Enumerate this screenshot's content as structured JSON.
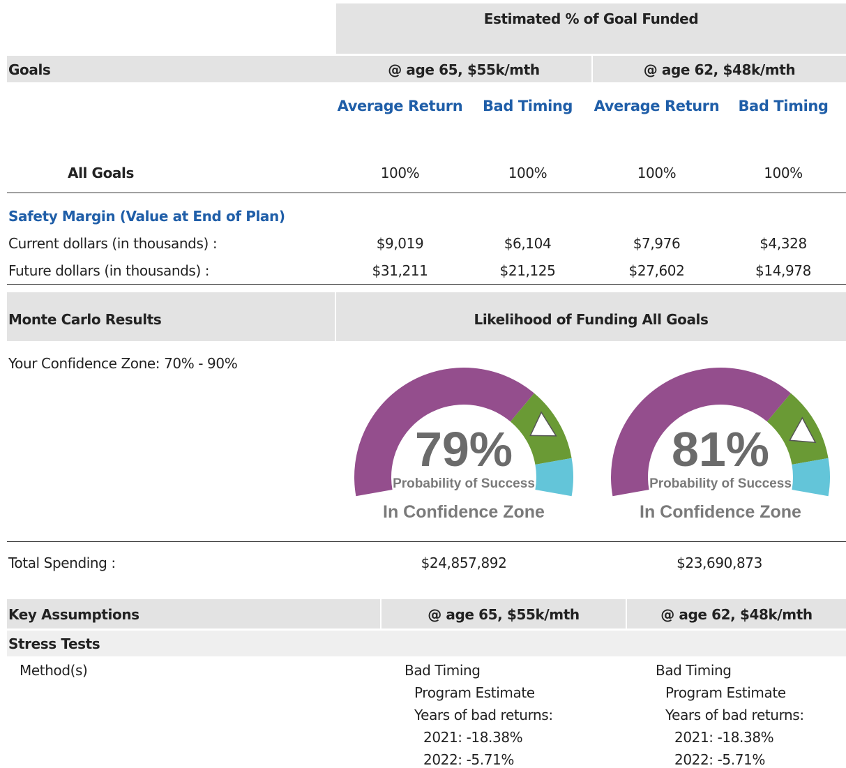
{
  "colors": {
    "header_bg": "#e3e3e3",
    "link_blue": "#1f5ea8",
    "gauge_purple": "#944e8d",
    "gauge_green": "#6a9a35",
    "gauge_cyan": "#63c5d9",
    "gauge_text": "#6b6b6b"
  },
  "funded": {
    "title": "Estimated % of Goal Funded",
    "goals_label": "Goals",
    "scenarios": [
      "@ age 65, $55k/mth",
      "@ age 62, $48k/mth"
    ],
    "subheaders": [
      "Average Return",
      "Bad Timing",
      "Average Return",
      "Bad Timing"
    ],
    "all_goals_label": "All Goals",
    "all_goals_values": [
      "100%",
      "100%",
      "100%",
      "100%"
    ]
  },
  "safety": {
    "title": "Safety Margin (Value at End of Plan)",
    "rows": [
      {
        "label": "Current dollars (in thousands) :",
        "values": [
          "$9,019",
          "$6,104",
          "$7,976",
          "$4,328"
        ]
      },
      {
        "label": "Future dollars (in thousands) :",
        "values": [
          "$31,211",
          "$21,125",
          "$27,602",
          "$14,978"
        ]
      }
    ]
  },
  "monte_carlo": {
    "title": "Monte Carlo Results",
    "likelihood_title": "Likelihood of Funding All Goals",
    "confidence_zone": "Your Confidence Zone: 70% - 90%",
    "zone_low": 70,
    "zone_high": 90,
    "gauges": [
      {
        "value": 79,
        "percent_text": "79%",
        "caption": "Probability of Success",
        "status": "In Confidence Zone"
      },
      {
        "value": 81,
        "percent_text": "81%",
        "caption": "Probability of Success",
        "status": "In Confidence Zone"
      }
    ]
  },
  "spending": {
    "label": "Total Spending :",
    "values": [
      "$24,857,892",
      "$23,690,873"
    ]
  },
  "assumptions": {
    "title": "Key Assumptions",
    "scenarios": [
      "@ age 65, $55k/mth",
      "@ age 62, $48k/mth"
    ],
    "stress_tests_label": "Stress Tests",
    "method_label": "Method(s)",
    "methods": [
      {
        "name": "Bad Timing",
        "estimate": "Program Estimate",
        "years_label": "Years of bad returns:",
        "years": [
          "2021: -18.38%",
          "2022: -5.71%"
        ]
      },
      {
        "name": "Bad Timing",
        "estimate": "Program Estimate",
        "years_label": "Years of bad returns:",
        "years": [
          "2021: -18.38%",
          "2022: -5.71%"
        ]
      }
    ]
  }
}
